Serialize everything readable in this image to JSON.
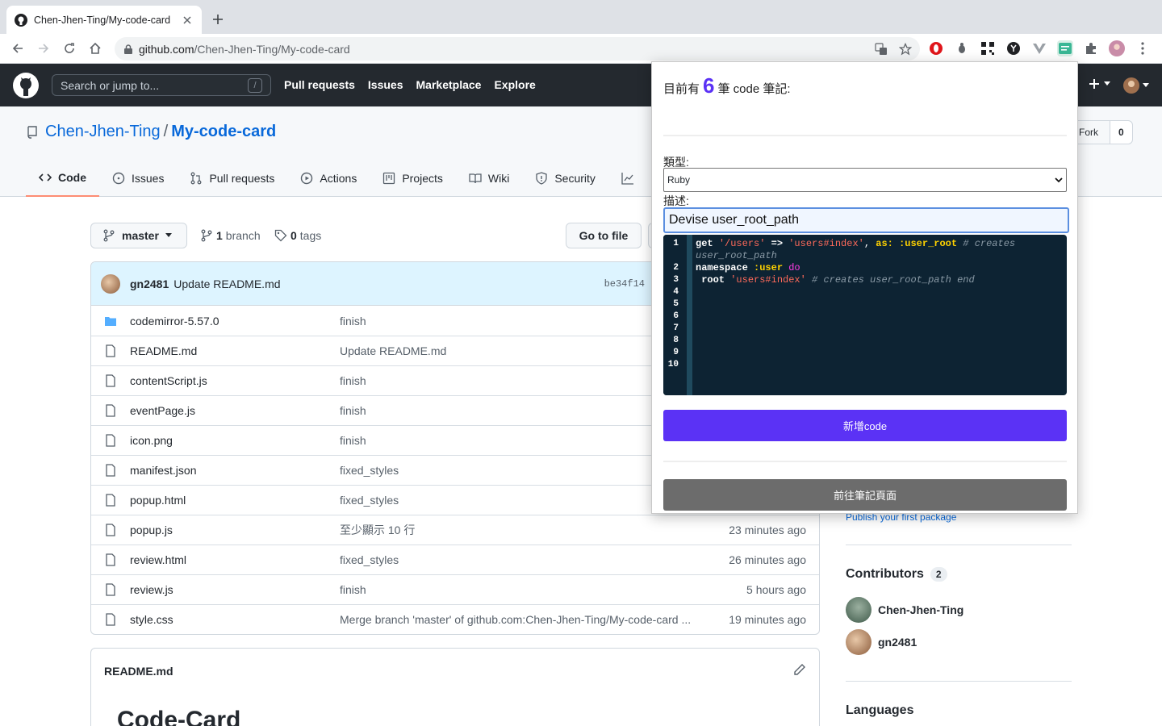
{
  "browser": {
    "tab_title": "Chen-Jhen-Ting/My-code-card",
    "url_host": "github.com",
    "url_path": "/Chen-Jhen-Ting/My-code-card"
  },
  "gh": {
    "search_placeholder": "Search or jump to...",
    "slash": "/",
    "nav": [
      "Pull requests",
      "Issues",
      "Marketplace",
      "Explore"
    ]
  },
  "repo": {
    "owner": "Chen-Jhen-Ting",
    "sep": "/",
    "name": "My-code-card",
    "fork_label": "Fork",
    "fork_count": "0",
    "tabs": [
      "Code",
      "Issues",
      "Pull requests",
      "Actions",
      "Projects",
      "Wiki",
      "Security"
    ]
  },
  "main": {
    "branch": "master",
    "branch_count": "1",
    "branch_label": "branch",
    "tag_count": "0",
    "tag_label": "tags",
    "goto_file": "Go to file",
    "commit": {
      "author": "gn2481",
      "message": "Update README.md",
      "sha": "be34f14"
    },
    "files": [
      {
        "name": "codemirror-5.57.0",
        "msg": "finish",
        "age": "",
        "type": "dir"
      },
      {
        "name": "README.md",
        "msg": "Update README.md",
        "age": "",
        "type": "file"
      },
      {
        "name": "contentScript.js",
        "msg": "finish",
        "age": "",
        "type": "file"
      },
      {
        "name": "eventPage.js",
        "msg": "finish",
        "age": "",
        "type": "file"
      },
      {
        "name": "icon.png",
        "msg": "finish",
        "age": "",
        "type": "file"
      },
      {
        "name": "manifest.json",
        "msg": "fixed_styles",
        "age": "",
        "type": "file"
      },
      {
        "name": "popup.html",
        "msg": "fixed_styles",
        "age": "",
        "type": "file"
      },
      {
        "name": "popup.js",
        "msg": "至少顯示 10 行",
        "age": "23 minutes ago",
        "type": "file"
      },
      {
        "name": "review.html",
        "msg": "fixed_styles",
        "age": "26 minutes ago",
        "type": "file"
      },
      {
        "name": "review.js",
        "msg": "finish",
        "age": "5 hours ago",
        "type": "file"
      },
      {
        "name": "style.css",
        "msg": "Merge branch 'master' of github.com:Chen-Jhen-Ting/My-code-card ...",
        "age": "19 minutes ago",
        "type": "file"
      }
    ],
    "readme_title": "README.md",
    "readme_h1": "Code-Card"
  },
  "sidebar": {
    "publish_link": "Publish your first package",
    "contributors_title": "Contributors",
    "contributors_count": "2",
    "contributors": [
      "Chen-Jhen-Ting",
      "gn2481"
    ],
    "languages_title": "Languages"
  },
  "popup": {
    "count_prefix": "目前有",
    "count": "6",
    "count_suffix": "筆 code 筆記:",
    "type_label": "類型:",
    "type_value": "Ruby",
    "desc_label": "描述:",
    "desc_value": "Devise user_root_path",
    "line_numbers": [
      "1",
      "2",
      "3",
      "4",
      "5",
      "6",
      "7",
      "8",
      "9",
      "10"
    ],
    "code": {
      "l1_a": "get ",
      "l1_b": "'/users'",
      "l1_c": " => ",
      "l1_d": "'users#index'",
      "l1_e": ", ",
      "l1_f": "as:",
      "l1_g": " :user_root",
      "l1_h": " # creates",
      "l1_wrap": "user_root_path",
      "l2_a": "namespace ",
      "l2_b": ":user",
      "l2_c": " do",
      "l3_a": " root ",
      "l3_b": "'users#index'",
      "l3_c": " # creates user_root_path end"
    },
    "add_button": "新增code",
    "goto_button": "前往筆記頁面"
  }
}
